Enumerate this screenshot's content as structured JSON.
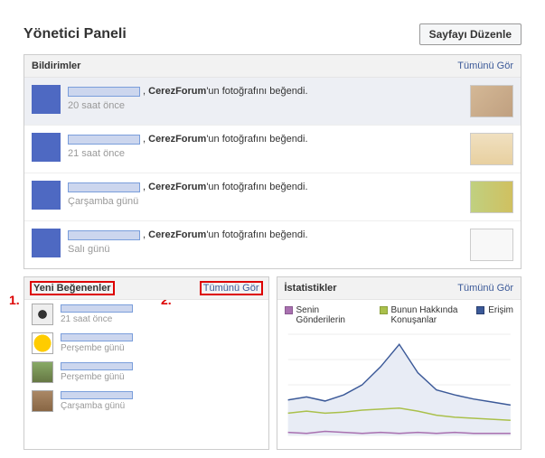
{
  "header": {
    "title": "Yönetici Paneli",
    "edit_button": "Sayfayı Düzenle"
  },
  "notifications": {
    "title": "Bildirimler",
    "see_all": "Tümünü Gör",
    "page_name": "CerezForum",
    "action_suffix": "'un fotoğrafını beğendi.",
    "items": [
      {
        "time": "20 saat önce",
        "highlighted": true
      },
      {
        "time": "21 saat önce",
        "highlighted": false
      },
      {
        "time": "Çarşamba günü",
        "highlighted": false
      },
      {
        "time": "Salı günü",
        "highlighted": false
      }
    ]
  },
  "new_likers": {
    "title": "Yeni Beğenenler",
    "see_all": "Tümünü Gör",
    "items": [
      {
        "time": "21 saat önce"
      },
      {
        "time": "Perşembe günü"
      },
      {
        "time": "Perşembe günü"
      },
      {
        "time": "Çarşamba günü"
      }
    ]
  },
  "stats": {
    "title": "İstatistikler",
    "see_all": "Tümünü Gör",
    "legend": {
      "posts": "Senin Gönderilerin",
      "talking": "Bunun Hakkında Konuşanlar",
      "reach": "Erişim"
    }
  },
  "annotations": {
    "one": "1.",
    "two": "2."
  },
  "chart_data": {
    "type": "line",
    "title": "",
    "xlabel": "",
    "ylabel": "",
    "ylim": [
      0,
      100
    ],
    "x": [
      0,
      1,
      2,
      3,
      4,
      5,
      6,
      7,
      8,
      9,
      10,
      11,
      12
    ],
    "series": [
      {
        "name": "Erişim",
        "color": "#3b5998",
        "values": [
          35,
          38,
          34,
          40,
          50,
          68,
          90,
          62,
          45,
          40,
          36,
          33,
          30
        ]
      },
      {
        "name": "Bunun Hakkında Konuşanlar",
        "color": "#aac04b",
        "values": [
          22,
          24,
          22,
          23,
          25,
          26,
          27,
          24,
          20,
          18,
          17,
          16,
          15
        ]
      },
      {
        "name": "Senin Gönderilerin",
        "color": "#a971b0",
        "values": [
          3,
          2,
          4,
          3,
          2,
          3,
          2,
          3,
          2,
          3,
          2,
          2,
          2
        ]
      }
    ]
  }
}
